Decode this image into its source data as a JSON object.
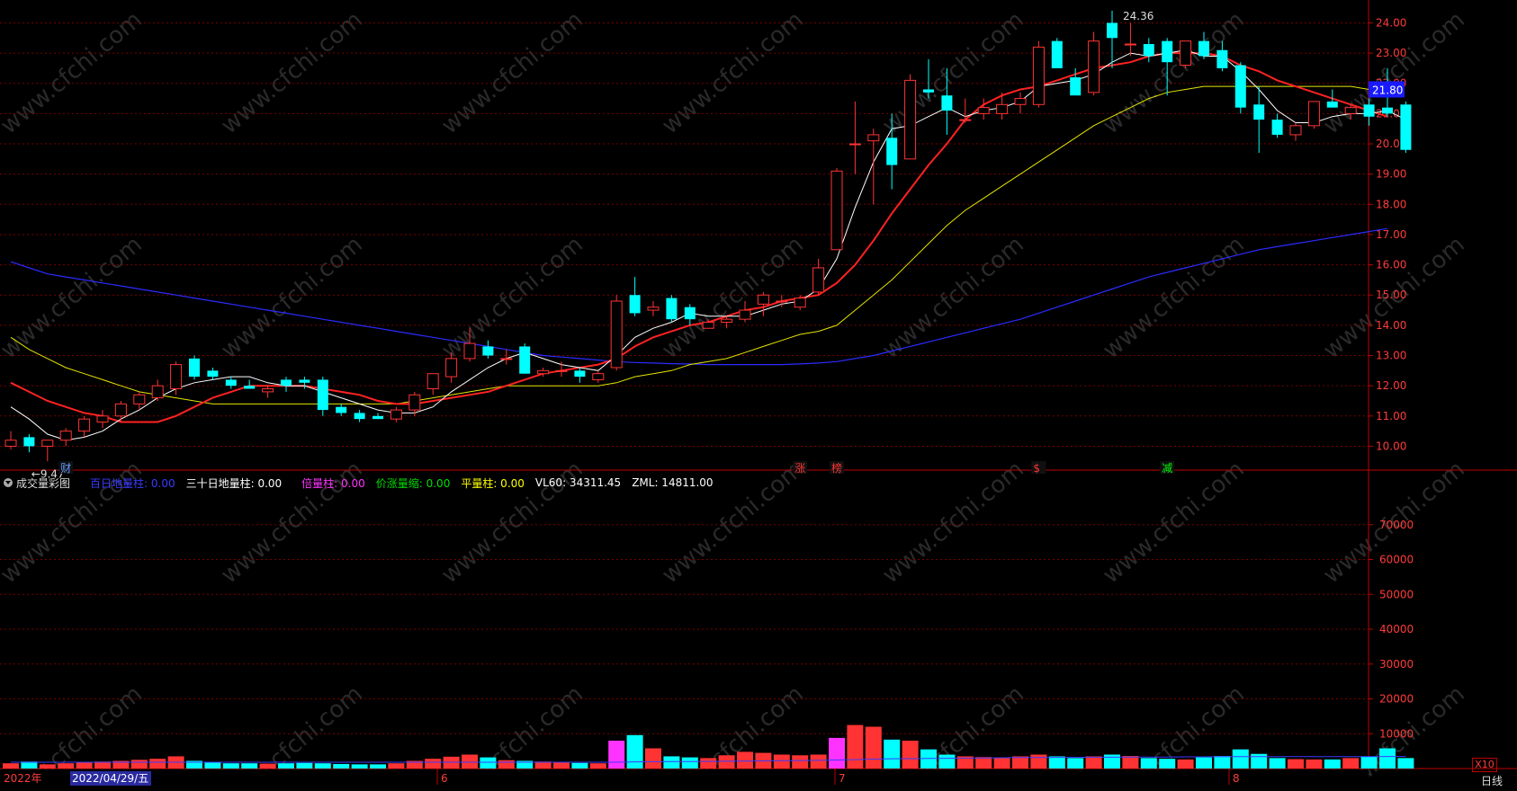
{
  "chart_data": [
    {
      "type": "candlestick",
      "title": "",
      "y_ticks": [
        "24.00",
        "23.00",
        "22.00",
        "21.00",
        "20.00",
        "19.00",
        "18.00",
        "17.00",
        "16.00",
        "15.00",
        "14.00",
        "13.00",
        "12.00",
        "11.00",
        "10.00"
      ],
      "ylim": [
        9.3,
        24.4
      ],
      "current_price_label": "21.80",
      "current_price_value": 21.8,
      "max_label": "24.36",
      "min_label": "←9.47",
      "event_markers": [
        "财",
        "涨",
        "榜",
        "$",
        "减"
      ],
      "candles": [
        [
          10.0,
          10.5,
          9.9,
          10.2
        ],
        [
          10.3,
          10.4,
          9.8,
          10.0
        ],
        [
          10.0,
          10.2,
          9.5,
          10.2
        ],
        [
          10.2,
          10.6,
          10.0,
          10.5
        ],
        [
          10.5,
          11.0,
          10.3,
          10.9
        ],
        [
          10.8,
          11.2,
          10.6,
          11.0
        ],
        [
          11.0,
          11.5,
          10.8,
          11.4
        ],
        [
          11.4,
          11.8,
          11.2,
          11.7
        ],
        [
          11.6,
          12.2,
          11.5,
          12.0
        ],
        [
          11.9,
          12.8,
          11.7,
          12.7
        ],
        [
          12.9,
          13.0,
          12.2,
          12.3
        ],
        [
          12.5,
          12.6,
          12.2,
          12.3
        ],
        [
          12.2,
          12.3,
          11.9,
          12.0
        ],
        [
          12.0,
          12.2,
          11.9,
          11.9
        ],
        [
          11.8,
          12.0,
          11.6,
          11.9
        ],
        [
          12.2,
          12.3,
          11.8,
          12.0
        ],
        [
          12.2,
          12.3,
          11.9,
          12.1
        ],
        [
          12.2,
          12.3,
          11.0,
          11.2
        ],
        [
          11.3,
          11.4,
          11.0,
          11.1
        ],
        [
          11.1,
          11.2,
          10.8,
          10.9
        ],
        [
          11.0,
          11.1,
          10.9,
          10.9
        ],
        [
          10.9,
          11.3,
          10.8,
          11.2
        ],
        [
          11.2,
          11.8,
          11.0,
          11.7
        ],
        [
          11.9,
          12.4,
          11.7,
          12.4
        ],
        [
          12.3,
          13.1,
          12.1,
          12.9
        ],
        [
          12.9,
          13.9,
          12.8,
          13.4
        ],
        [
          13.3,
          13.5,
          12.9,
          13.0
        ],
        [
          12.9,
          13.2,
          12.7,
          12.9
        ],
        [
          13.3,
          13.4,
          12.4,
          12.4
        ],
        [
          12.4,
          12.6,
          12.3,
          12.5
        ],
        [
          12.5,
          12.8,
          12.3,
          12.5
        ],
        [
          12.5,
          12.6,
          12.1,
          12.3
        ],
        [
          12.2,
          12.5,
          12.1,
          12.4
        ],
        [
          12.6,
          15.0,
          12.5,
          14.8
        ],
        [
          15.0,
          15.6,
          14.3,
          14.4
        ],
        [
          14.5,
          14.8,
          14.3,
          14.6
        ],
        [
          14.9,
          15.0,
          14.1,
          14.2
        ],
        [
          14.6,
          14.7,
          14.0,
          14.2
        ],
        [
          13.9,
          14.2,
          13.9,
          14.1
        ],
        [
          14.1,
          14.3,
          13.9,
          14.2
        ],
        [
          14.2,
          14.8,
          14.1,
          14.5
        ],
        [
          14.7,
          15.1,
          14.3,
          15.0
        ],
        [
          14.8,
          15.0,
          14.6,
          14.8
        ],
        [
          14.6,
          15.0,
          14.5,
          14.9
        ],
        [
          15.1,
          16.2,
          15.0,
          15.9
        ],
        [
          16.5,
          19.2,
          16.5,
          19.1
        ],
        [
          20.0,
          21.4,
          19.0,
          20.0
        ],
        [
          20.1,
          20.5,
          18.0,
          20.3
        ],
        [
          20.2,
          21.0,
          18.5,
          19.3
        ],
        [
          19.5,
          22.3,
          19.5,
          22.1
        ],
        [
          21.8,
          22.8,
          21.5,
          21.7
        ],
        [
          21.6,
          22.5,
          20.3,
          21.1
        ],
        [
          20.8,
          21.5,
          20.7,
          20.8
        ],
        [
          21.0,
          21.5,
          20.8,
          21.2
        ],
        [
          21.0,
          21.7,
          20.8,
          21.3
        ],
        [
          21.3,
          21.7,
          21.0,
          21.5
        ],
        [
          21.3,
          23.4,
          21.2,
          23.2
        ],
        [
          23.4,
          23.5,
          22.5,
          22.5
        ],
        [
          22.2,
          22.5,
          21.7,
          21.6
        ],
        [
          21.7,
          23.7,
          21.6,
          23.4
        ],
        [
          24.0,
          24.4,
          22.5,
          23.5
        ],
        [
          23.3,
          24.0,
          22.9,
          23.3
        ],
        [
          23.3,
          23.5,
          22.7,
          22.9
        ],
        [
          23.4,
          23.5,
          21.6,
          22.7
        ],
        [
          22.6,
          23.4,
          22.5,
          23.4
        ],
        [
          23.4,
          23.7,
          22.8,
          22.9
        ],
        [
          23.1,
          23.4,
          22.4,
          22.5
        ],
        [
          22.6,
          22.7,
          21.0,
          21.2
        ],
        [
          21.3,
          21.9,
          19.7,
          20.8
        ],
        [
          20.8,
          21.0,
          20.2,
          20.3
        ],
        [
          20.3,
          20.7,
          20.1,
          20.6
        ],
        [
          20.6,
          21.2,
          20.5,
          21.4
        ],
        [
          21.4,
          21.8,
          21.2,
          21.2
        ],
        [
          21.0,
          21.3,
          20.8,
          21.2
        ],
        [
          21.3,
          21.5,
          20.6,
          20.9
        ],
        [
          21.2,
          22.5,
          20.9,
          21.0
        ],
        [
          21.3,
          21.4,
          19.7,
          19.8
        ]
      ],
      "ma5": [
        11.3,
        10.9,
        10.4,
        10.2,
        10.3,
        10.5,
        10.9,
        11.2,
        11.6,
        11.9,
        12.1,
        12.2,
        12.3,
        12.3,
        12.1,
        12.0,
        12.0,
        11.8,
        11.6,
        11.4,
        11.2,
        11.1,
        11.1,
        11.3,
        11.8,
        12.2,
        12.6,
        12.9,
        13.1,
        12.9,
        12.7,
        12.6,
        12.5,
        13.0,
        13.6,
        13.9,
        14.1,
        14.4,
        14.3,
        14.3,
        14.3,
        14.5,
        14.7,
        14.8,
        15.2,
        16.2,
        17.9,
        19.4,
        20.5,
        20.6,
        20.9,
        21.2,
        20.9,
        21.1,
        21.2,
        21.4,
        21.9,
        22.0,
        22.1,
        22.3,
        22.7,
        23.0,
        22.9,
        23.0,
        23.1,
        22.9,
        22.9,
        22.4,
        21.8,
        21.1,
        20.7,
        20.7,
        20.9,
        21.0,
        21.0,
        21.1,
        20.8
      ],
      "ma10": [
        12.1,
        11.8,
        11.5,
        11.3,
        11.1,
        11.0,
        10.8,
        10.8,
        10.8,
        11.0,
        11.3,
        11.6,
        11.8,
        12.0,
        12.0,
        12.0,
        12.0,
        11.9,
        11.8,
        11.7,
        11.5,
        11.4,
        11.4,
        11.5,
        11.6,
        11.7,
        11.8,
        12.0,
        12.2,
        12.4,
        12.5,
        12.6,
        12.7,
        12.9,
        13.3,
        13.6,
        13.8,
        14.0,
        14.1,
        14.3,
        14.5,
        14.6,
        14.8,
        14.9,
        15.0,
        15.4,
        16.0,
        16.8,
        17.7,
        18.5,
        19.3,
        20.0,
        20.8,
        21.3,
        21.6,
        21.8,
        21.9,
        22.1,
        22.3,
        22.5,
        22.6,
        22.7,
        22.9,
        23.0,
        23.0,
        23.0,
        22.9,
        22.6,
        22.4,
        22.1,
        21.9,
        21.7,
        21.5,
        21.3,
        21.1,
        20.9
      ],
      "ma20": [
        13.6,
        13.2,
        12.9,
        12.6,
        12.4,
        12.2,
        12.0,
        11.8,
        11.7,
        11.6,
        11.5,
        11.4,
        11.4,
        11.4,
        11.4,
        11.4,
        11.4,
        11.4,
        11.4,
        11.4,
        11.4,
        11.4,
        11.5,
        11.6,
        11.7,
        11.8,
        11.9,
        12.0,
        12.0,
        12.0,
        12.0,
        12.0,
        12.0,
        12.1,
        12.3,
        12.4,
        12.5,
        12.7,
        12.8,
        12.9,
        13.1,
        13.3,
        13.5,
        13.7,
        13.8,
        14.0,
        14.5,
        15.0,
        15.5,
        16.1,
        16.7,
        17.3,
        17.8,
        18.2,
        18.6,
        19.0,
        19.4,
        19.8,
        20.2,
        20.6,
        20.9,
        21.2,
        21.5,
        21.7,
        21.8,
        21.9,
        21.9,
        21.9,
        21.9,
        21.9,
        21.9,
        21.9,
        21.9,
        21.9,
        21.8,
        21.8
      ],
      "ma60": [
        16.1,
        15.9,
        15.7,
        15.6,
        15.5,
        15.4,
        15.3,
        15.2,
        15.1,
        15.0,
        14.9,
        14.8,
        14.7,
        14.6,
        14.5,
        14.4,
        14.3,
        14.2,
        14.1,
        14.0,
        13.9,
        13.8,
        13.7,
        13.6,
        13.5,
        13.4,
        13.3,
        13.2,
        13.1,
        13.0,
        12.95,
        12.9,
        12.85,
        12.8,
        12.77,
        12.75,
        12.73,
        12.72,
        12.7,
        12.7,
        12.7,
        12.7,
        12.7,
        12.72,
        12.75,
        12.8,
        12.9,
        13.0,
        13.15,
        13.3,
        13.45,
        13.6,
        13.75,
        13.9,
        14.05,
        14.2,
        14.4,
        14.6,
        14.8,
        15.0,
        15.2,
        15.4,
        15.6,
        15.75,
        15.9,
        16.05,
        16.2,
        16.35,
        16.5,
        16.6,
        16.7,
        16.8,
        16.9,
        17.0,
        17.1,
        17.2
      ]
    },
    {
      "type": "bar",
      "title": "成交量彩图",
      "y_ticks": [
        "70000",
        "60000",
        "50000",
        "40000",
        "30000",
        "20000",
        "10000"
      ],
      "ylim": [
        0,
        80000
      ],
      "volumes": [
        1500,
        2000,
        1200,
        1500,
        1800,
        2000,
        2200,
        2500,
        2800,
        3500,
        2200,
        1800,
        1500,
        1500,
        1400,
        1500,
        1600,
        1500,
        1300,
        1200,
        1200,
        1500,
        2200,
        2800,
        3400,
        4000,
        3200,
        2400,
        2200,
        2000,
        1800,
        1600,
        1500,
        8000,
        9600,
        5800,
        3500,
        3200,
        3000,
        3800,
        4800,
        4500,
        4000,
        3800,
        4000,
        8800,
        12500,
        12000,
        8300,
        8000,
        5500,
        4000,
        3500,
        3300,
        3000,
        3500,
        4000,
        3500,
        3000,
        3500,
        4000,
        3600,
        3000,
        2800,
        2600,
        3200,
        3600,
        5500,
        4200,
        3000,
        2700,
        2600,
        2600,
        3000,
        3500,
        5800,
        3000
      ],
      "vl60_line": [
        1800,
        1800,
        1800,
        1800,
        1800,
        1800,
        1800,
        1800,
        1800,
        1800,
        1800,
        1800,
        1800,
        1800,
        1800,
        1800,
        1800,
        1800,
        1800,
        1800,
        1800,
        1800,
        1800,
        1800,
        1800,
        1800,
        1800,
        1800,
        1800,
        1800,
        1800,
        1800,
        1800,
        1800,
        1900,
        1950,
        2000,
        2000,
        2050,
        2100,
        2150,
        2200,
        2250,
        2300,
        2350,
        2450,
        2550,
        2700,
        2800,
        2850,
        2900,
        2950,
        3000,
        3050,
        3100,
        3150,
        3150,
        3200,
        3200,
        3250,
        3250,
        3300,
        3300,
        3300,
        3350,
        3350,
        3400,
        3400,
        3400,
        3400,
        3400,
        3400,
        3400,
        3400,
        3400,
        3450,
        3450
      ]
    }
  ],
  "legend": {
    "panel_title": "成交量彩图",
    "items": [
      {
        "label": "百日地量柱: 0.00",
        "color": "#3a3aff"
      },
      {
        "label": "三十日地量柱: 0.00",
        "color": "#ffffff"
      },
      {
        "label": "倍量柱: 0.00",
        "color": "#ff33ff"
      },
      {
        "label": "价涨量缩: 0.00",
        "color": "#00dd00"
      },
      {
        "label": "平量柱: 0.00",
        "color": "#ffff00"
      },
      {
        "label": "VL60: 34311.45",
        "color": "#ffffff"
      },
      {
        "label": "ZML: 14811.00",
        "color": "#ffffff"
      }
    ]
  },
  "volume_scale_label": "X10",
  "time_axis": {
    "labels": [
      "2022年",
      "2022/04/29/五",
      "6",
      "7",
      "8"
    ],
    "period_label": "日线"
  },
  "watermark": "www.cfchi.com",
  "colors": {
    "up": "#ff3333",
    "down": "#00ffff",
    "ma5": "#ffffff",
    "ma10": "#ff2222",
    "ma20": "#e5e500",
    "ma60": "#2b2bff",
    "grid": "#7a0000",
    "axis": "#c00000",
    "price_tag_bg": "#1a1aff"
  }
}
